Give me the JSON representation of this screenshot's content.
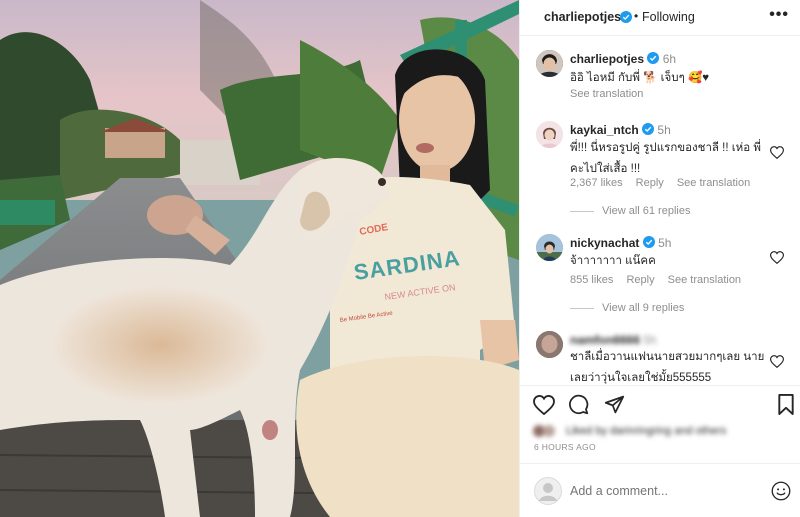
{
  "header": {
    "username": "charliepotjes",
    "follow_separator": "•",
    "follow_status": "Following",
    "more_label": "•••"
  },
  "post": {
    "username": "charliepotjes",
    "time": "6h",
    "caption": "อิอิ ไอหมี กับพี่ 🐕 เจ็บๆ 🥰♥",
    "see_translation": "See translation"
  },
  "comments": [
    {
      "username": "kaykai_ntch",
      "time": "5h",
      "text_line1": "พี่!!! นี่หรอรูปคู่ รูปแรกของชาลี !! เห่อ พี่",
      "text_line2": "คะไปใส่เสื้อ !!!",
      "likes": "2,367 likes",
      "reply": "Reply",
      "see_translation": "See translation",
      "view_replies": "View all 61 replies"
    },
    {
      "username": "nickynachat",
      "time": "5h",
      "text_line1": "จ้าาาาาาา แน๊คค",
      "likes": "855 likes",
      "reply": "Reply",
      "see_translation": "See translation",
      "view_replies": "View all 9 replies"
    },
    {
      "username": "namfon6666",
      "time": "5h",
      "text_line1": "ชาลีเมื่อวานแฟนนายสวยมากๆเลย นาย",
      "text_line2": "เลยว่าวุ่นใจเลยใช่มั้ย555555"
    }
  ],
  "likes_summary": "Liked by darinringring and others",
  "time_ago": "6 HOURS AGO",
  "add_comment_placeholder": "Add a comment...",
  "photo": {
    "shirt_text": "SARDINA",
    "shirt_sub": "NEW ACTIVE ON",
    "shirt_small": "Be Mobile Be Active",
    "shirt_code": "CODE"
  },
  "colors": {
    "verified": "#1d9bf0",
    "meta_gray": "#8e8e8e",
    "text": "#262626"
  }
}
